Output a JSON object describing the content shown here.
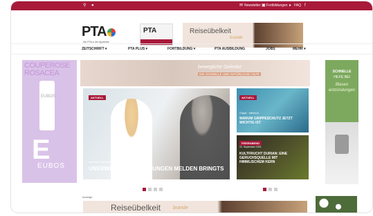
{
  "topbar": {
    "newsletter": "Newsletter",
    "fortbildungen": "Fortbildungen",
    "faq": "FAQ"
  },
  "header": {
    "logo_text": "PTA",
    "tagline": "Die PTA in der Apotheke",
    "magazine_title": "PTA",
    "banner_title": "Reiseübelkeit",
    "banner_subtitle": "brande"
  },
  "nav": {
    "items": [
      "ZEITSCHRIFT ▾",
      "PTA PLUS ▾",
      "FORTBILDUNG ▾",
      "PTA AUSBILDUNG",
      "JOBS",
      "MEHR ▾"
    ]
  },
  "left_ad": {
    "word1": "COUPEROSE",
    "word2": "ROSACEA",
    "tube_label": "EUBOS",
    "big_letter": "E",
    "brand": "EUBOS"
  },
  "right_ad": {
    "line1": "SCHNELLE",
    "line2": "HILFE BEI",
    "line3": "Blasen\nentzündungen"
  },
  "strip_ad": {
    "headline": "bewegliche Gelenke",
    "subline": "DIE SCHNELLE UND NATÜRLICHE HILFE"
  },
  "hero": {
    "badge": "AKTUELL",
    "date": "Aktuelle Nachrichten",
    "headline": "UNERWÜNSCHTE WIRKUNGEN MELDEN BRINGTS"
  },
  "card1": {
    "badge": "AKTUELL",
    "date": "Grippe · Influenza",
    "headline": "WARUM GRIPPESCHUTZ JETZT WICHTIG IST"
  },
  "card2": {
    "badge": "FEIERABEND",
    "date": "24. September 2021",
    "headline": "KULTFRUCHT DURIAN: EINE GERUCHSQUELLE MIT HIMMLISCHEM KERN"
  },
  "below": {
    "anzeige": "Anzeige",
    "banner_title": "Reiseübelkeit",
    "banner_subtitle": "brande"
  },
  "colors": {
    "brand": "#a8193a"
  }
}
